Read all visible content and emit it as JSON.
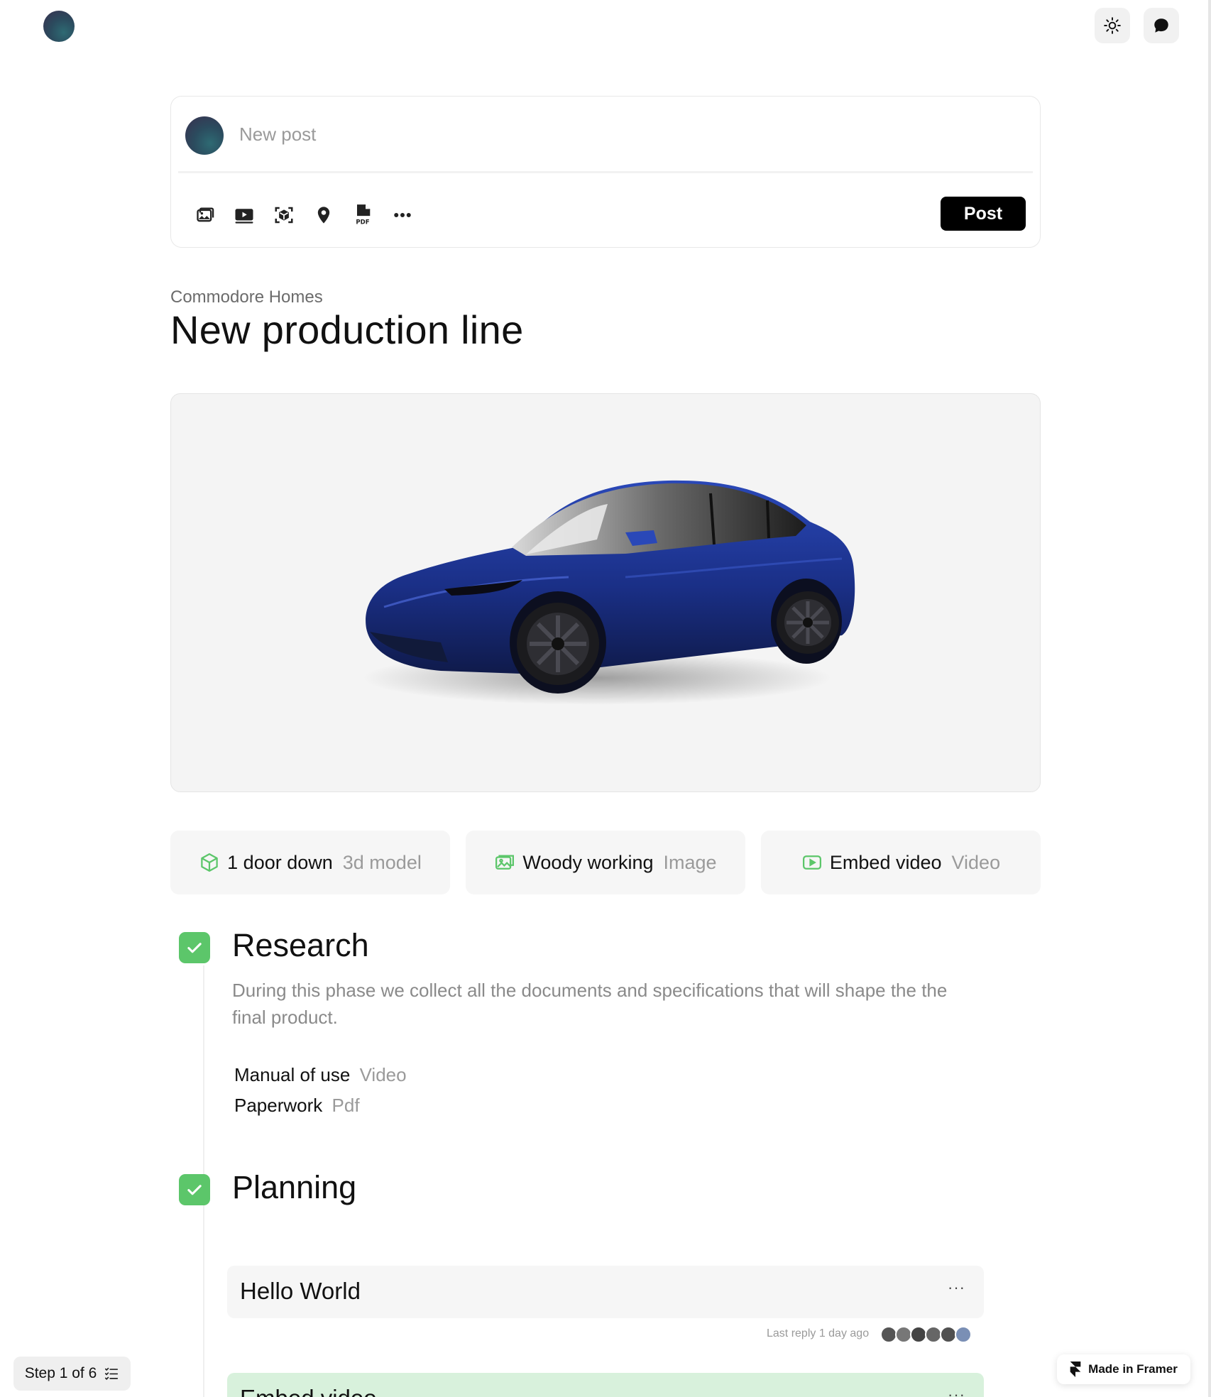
{
  "composer": {
    "placeholder": "New post",
    "post_label": "Post",
    "tools": [
      "image-icon",
      "video-icon",
      "3d-scan-icon",
      "location-pin-icon",
      "pdf-icon",
      "more-icon"
    ]
  },
  "header": {
    "theme_icon": "sun-icon",
    "chat_icon": "chat-bubble-icon"
  },
  "project": {
    "org": "Commodore Homes",
    "title": "New production line"
  },
  "attachments": [
    {
      "name": "1 door down",
      "type": "3d model",
      "icon": "cube-icon"
    },
    {
      "name": "Woody working",
      "type": "Image",
      "icon": "image-icon"
    },
    {
      "name": "Embed video",
      "type": "Video",
      "icon": "play-icon"
    }
  ],
  "steps": [
    {
      "title": "Research",
      "description": "During this phase we collect all the documents and specifications that will shape the the final product.",
      "docs": [
        {
          "name": "Manual of use",
          "type": "Video"
        },
        {
          "name": "Paperwork",
          "type": "Pdf"
        }
      ]
    },
    {
      "title": "Planning",
      "threads": [
        {
          "title": "Hello World",
          "menu": "···",
          "meta": "Last reply 1 day ago"
        },
        {
          "title": "Embed video",
          "menu": "···"
        }
      ]
    }
  ],
  "footer": {
    "step_indicator": "Step 1 of 6",
    "made_in": "Made in Framer"
  },
  "colors": {
    "accent_green": "#5cc66a",
    "post_button": "#000000"
  }
}
